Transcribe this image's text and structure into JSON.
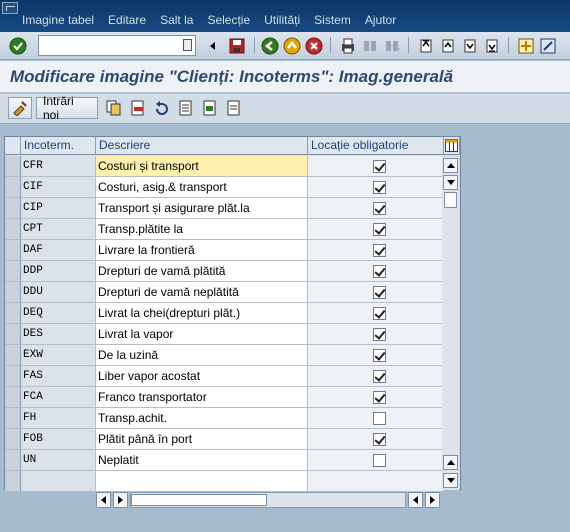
{
  "menu": [
    "Imagine tabel",
    "Editare",
    "Salt la",
    "Selecție",
    "Utilități",
    "Sistem",
    "Ajutor"
  ],
  "command_field": {
    "value": ""
  },
  "title": "Modificare imagine \"Clienți: Incoterms\": Imag.generală",
  "app_toolbar": {
    "new_entries_label": "Intrări noi"
  },
  "table": {
    "columns": [
      "Incoterm.",
      "Descriere",
      "Locație obligatorie"
    ],
    "rows": [
      {
        "code": "CFR",
        "desc": "Costuri și transport",
        "required": true
      },
      {
        "code": "CIF",
        "desc": "Costuri, asig.& transport",
        "required": true
      },
      {
        "code": "CIP",
        "desc": "Transport și asigurare plăt.la",
        "required": true
      },
      {
        "code": "CPT",
        "desc": "Transp.plătite la",
        "required": true
      },
      {
        "code": "DAF",
        "desc": "Livrare la frontieră",
        "required": true
      },
      {
        "code": "DDP",
        "desc": "Drepturi de vamă plătită",
        "required": true
      },
      {
        "code": "DDU",
        "desc": "Drepturi de vamă neplătită",
        "required": true
      },
      {
        "code": "DEQ",
        "desc": "Livrat la chei(drepturi plăt.)",
        "required": true
      },
      {
        "code": "DES",
        "desc": "Livrat la vapor",
        "required": true
      },
      {
        "code": "EXW",
        "desc": "De la uzină",
        "required": true
      },
      {
        "code": "FAS",
        "desc": "Liber vapor acostat",
        "required": true
      },
      {
        "code": "FCA",
        "desc": "Franco transportator",
        "required": true
      },
      {
        "code": "FH",
        "desc": "Transp.achit.",
        "required": false
      },
      {
        "code": "FOB",
        "desc": "Plătit până în port",
        "required": true
      },
      {
        "code": "UN",
        "desc": "Neplatit",
        "required": false
      },
      {
        "code": "",
        "desc": "",
        "required": null
      }
    ]
  },
  "colors": {
    "menubar": "#0a3769",
    "title_text": "#2b4a72",
    "active_cell": "#fff0b0"
  }
}
